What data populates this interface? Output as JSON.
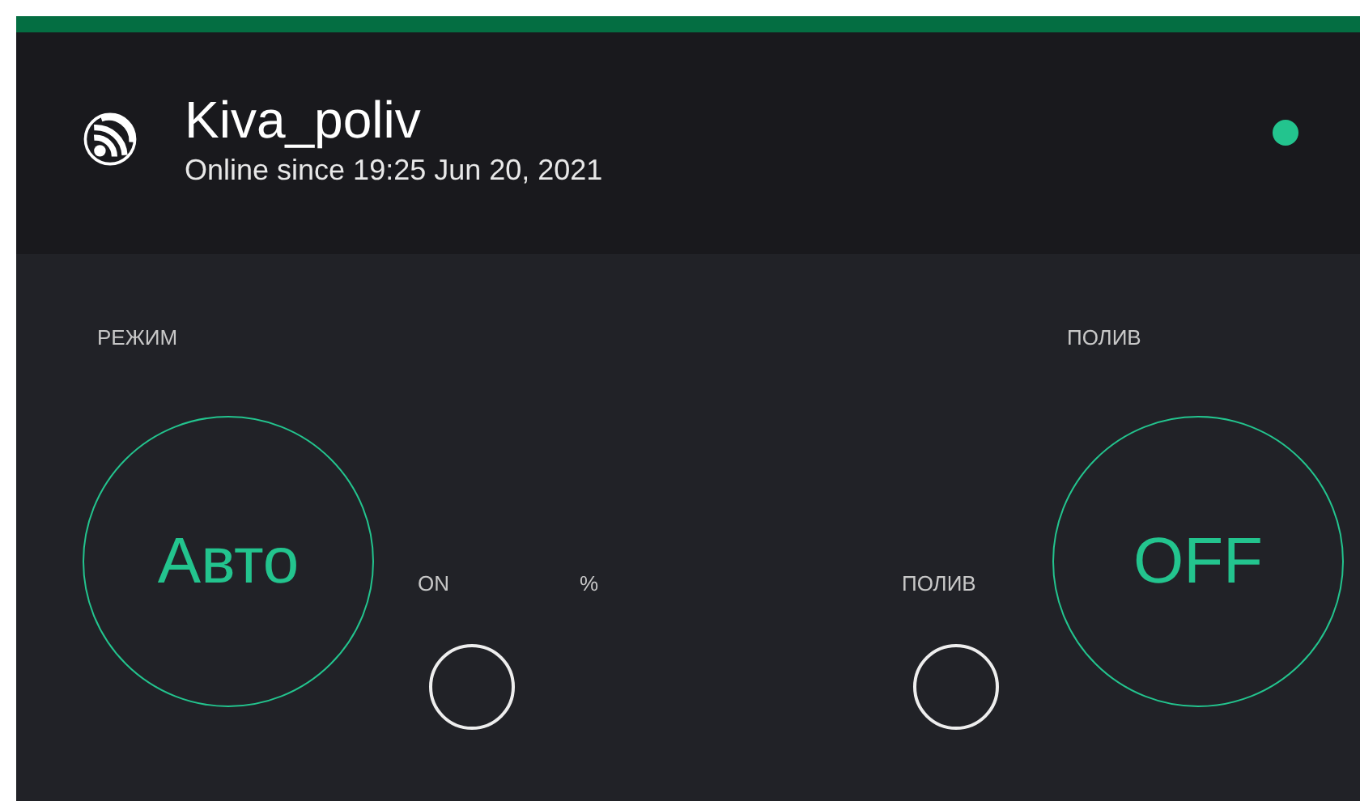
{
  "header": {
    "title": "Kiva_poliv",
    "status": "Online since 19:25 Jun 20, 2021",
    "online": true
  },
  "widgets": [
    {
      "kind": "button",
      "title": "РЕЖИМ",
      "state_text": "Авто"
    },
    {
      "kind": "led",
      "label": "ON",
      "on": false
    },
    {
      "kind": "display",
      "label": "%"
    },
    {
      "kind": "led",
      "label": "ПОЛИВ",
      "on": false
    },
    {
      "kind": "button",
      "title": "ПОЛИВ",
      "state_text": "OFF"
    }
  ]
}
